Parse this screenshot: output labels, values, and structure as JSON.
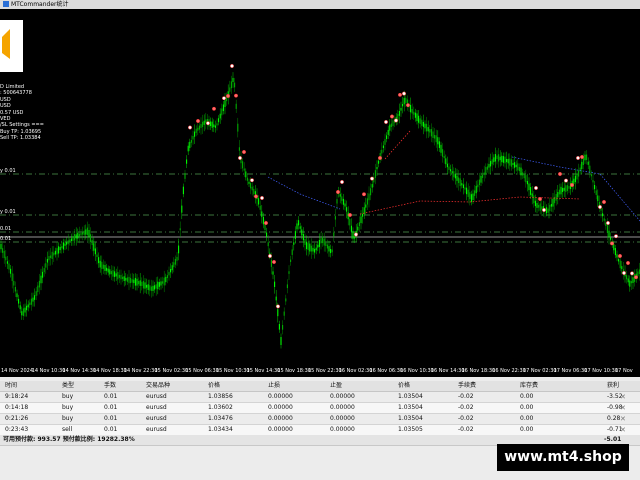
{
  "window": {
    "title": "MTCommander统计"
  },
  "account_info": [
    "D Limited",
    ": 500643778",
    "USD",
    "USD",
    "0.57 USD",
    "VED",
    "/SL Settings ===",
    "Buy TP: 1.03695",
    "Sell TP: 1.03384"
  ],
  "level_labels": [
    "y 0.01",
    "y 0.01",
    "0.01",
    "0.01"
  ],
  "time_axis": [
    "14 Nov 2024",
    "14 Nov 10:30",
    "14 Nov 14:30",
    "14 Nov 18:30",
    "14 Nov 22:30",
    "15 Nov 02:30",
    "15 Nov 06:30",
    "15 Nov 10:30",
    "15 Nov 14:30",
    "15 Nov 18:30",
    "15 Nov 22:30",
    "16 Nov 02:30",
    "16 Nov 06:30",
    "16 Nov 10:30",
    "16 Nov 14:30",
    "16 Nov 18:30",
    "16 Nov 22:30",
    "17 Nov 02:30",
    "17 Nov 06:30",
    "17 Nov 10:30",
    "17 Nov"
  ],
  "colors": {
    "bull": "#00ff00",
    "bear": "#00b000",
    "level_line": "#4f9a4f",
    "bid_line": "#c8c8c8",
    "trend_red": "#ff3030",
    "trend_blue": "#4060ff"
  },
  "icons": {
    "window": "app-icon",
    "close": "close-icon"
  },
  "orders": {
    "columns": [
      "时间",
      "类型",
      "手数",
      "交易品种",
      "价格",
      "止损",
      "止盈",
      "价格",
      "手续费",
      "库存费",
      "获利"
    ],
    "rows": [
      {
        "time": "9:18:24",
        "type": "buy",
        "lots": "0.01",
        "symbol": "eurusd",
        "price": "1.03856",
        "sl": "0.00000",
        "tp": "0.00000",
        "cur_price": "1.03504",
        "commission": "-0.02",
        "swap": "0.00",
        "profit": "-3.52"
      },
      {
        "time": "0:14:18",
        "type": "buy",
        "lots": "0.01",
        "symbol": "eurusd",
        "price": "1.03602",
        "sl": "0.00000",
        "tp": "0.00000",
        "cur_price": "1.03504",
        "commission": "-0.02",
        "swap": "0.00",
        "profit": "-0.98"
      },
      {
        "time": "0:21:26",
        "type": "buy",
        "lots": "0.01",
        "symbol": "eurusd",
        "price": "1.03476",
        "sl": "0.00000",
        "tp": "0.00000",
        "cur_price": "1.03504",
        "commission": "-0.02",
        "swap": "0.00",
        "profit": "0.28"
      },
      {
        "time": "0:23:43",
        "type": "sell",
        "lots": "0.01",
        "symbol": "eurusd",
        "price": "1.03434",
        "sl": "0.00000",
        "tp": "0.00000",
        "cur_price": "1.03505",
        "commission": "-0.02",
        "swap": "0.00",
        "profit": "-0.71"
      }
    ],
    "footer": {
      "summary": "可用预付款: 993.57  预付款比例: 19282.38%",
      "total": "-5.01"
    }
  },
  "watermark": "www.mt4.shop"
}
